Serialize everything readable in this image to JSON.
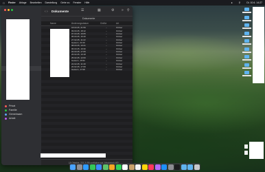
{
  "menubar": {
    "apple": "",
    "items": [
      "Finder",
      "Ablage",
      "Bearbeiten",
      "Darstellung",
      "Gehe zu",
      "Fenster",
      "Hilfe"
    ],
    "clock": "Di. 10.6. 14:27"
  },
  "finder": {
    "title": "Dokumente",
    "path_label": "Dokumente",
    "columns": {
      "name": "Name",
      "date": "Änderungsdatum",
      "size": "Größe",
      "kind": "Art"
    },
    "rows": [
      {
        "date": "18.03.25, 21:59",
        "size": "--",
        "kind": "Ordner"
      },
      {
        "date": "09.03.25, 18:12",
        "size": "--",
        "kind": "Ordner"
      },
      {
        "date": "07.03.25, 19:05",
        "size": "--",
        "kind": "Ordner"
      },
      {
        "date": "05.03.25, 16:40",
        "size": "--",
        "kind": "Ordner"
      },
      {
        "date": "27.02.25, 11:22",
        "size": "--",
        "kind": "Ordner"
      },
      {
        "date": "Gestern, 23:16",
        "size": "--",
        "kind": "Ordner"
      },
      {
        "date": "08.03.25, 10:21",
        "size": "--",
        "kind": "Ordner"
      },
      {
        "date": "06.03.25, 19:30",
        "size": "--",
        "kind": "Ordner"
      },
      {
        "date": "04.03.25, 17:05",
        "size": "--",
        "kind": "Ordner"
      },
      {
        "date": "26.02.25, 10:18",
        "size": "--",
        "kind": "Ordner"
      },
      {
        "date": "25.02.25, 12:00",
        "size": "--",
        "kind": "Ordner"
      },
      {
        "date": "Gestern, 15:52",
        "size": "--",
        "kind": "Ordner"
      },
      {
        "date": "22.02.25, 11:49",
        "size": "--",
        "kind": "Ordner"
      },
      {
        "date": "20.02.25, 17:09",
        "size": "--",
        "kind": "Ordner"
      },
      {
        "date": "Gestern, 17:08",
        "size": "--",
        "kind": "Ordner"
      }
    ],
    "status": "15 Objekte, 221,3 GB verfügbar auf „Macintosh HD“"
  },
  "sidebar": {
    "tags": [
      {
        "label": "Privat",
        "color": "#ff5f57"
      },
      {
        "label": "Familie",
        "color": "#ffbd2e"
      },
      {
        "label": "Gemeinsam",
        "color": "#28c840"
      },
      {
        "label": "Arbeit",
        "color": "#5fa8ff"
      }
    ]
  },
  "colors": {
    "accent": "#5fb3ef",
    "window_bg": "#1e1e20"
  }
}
